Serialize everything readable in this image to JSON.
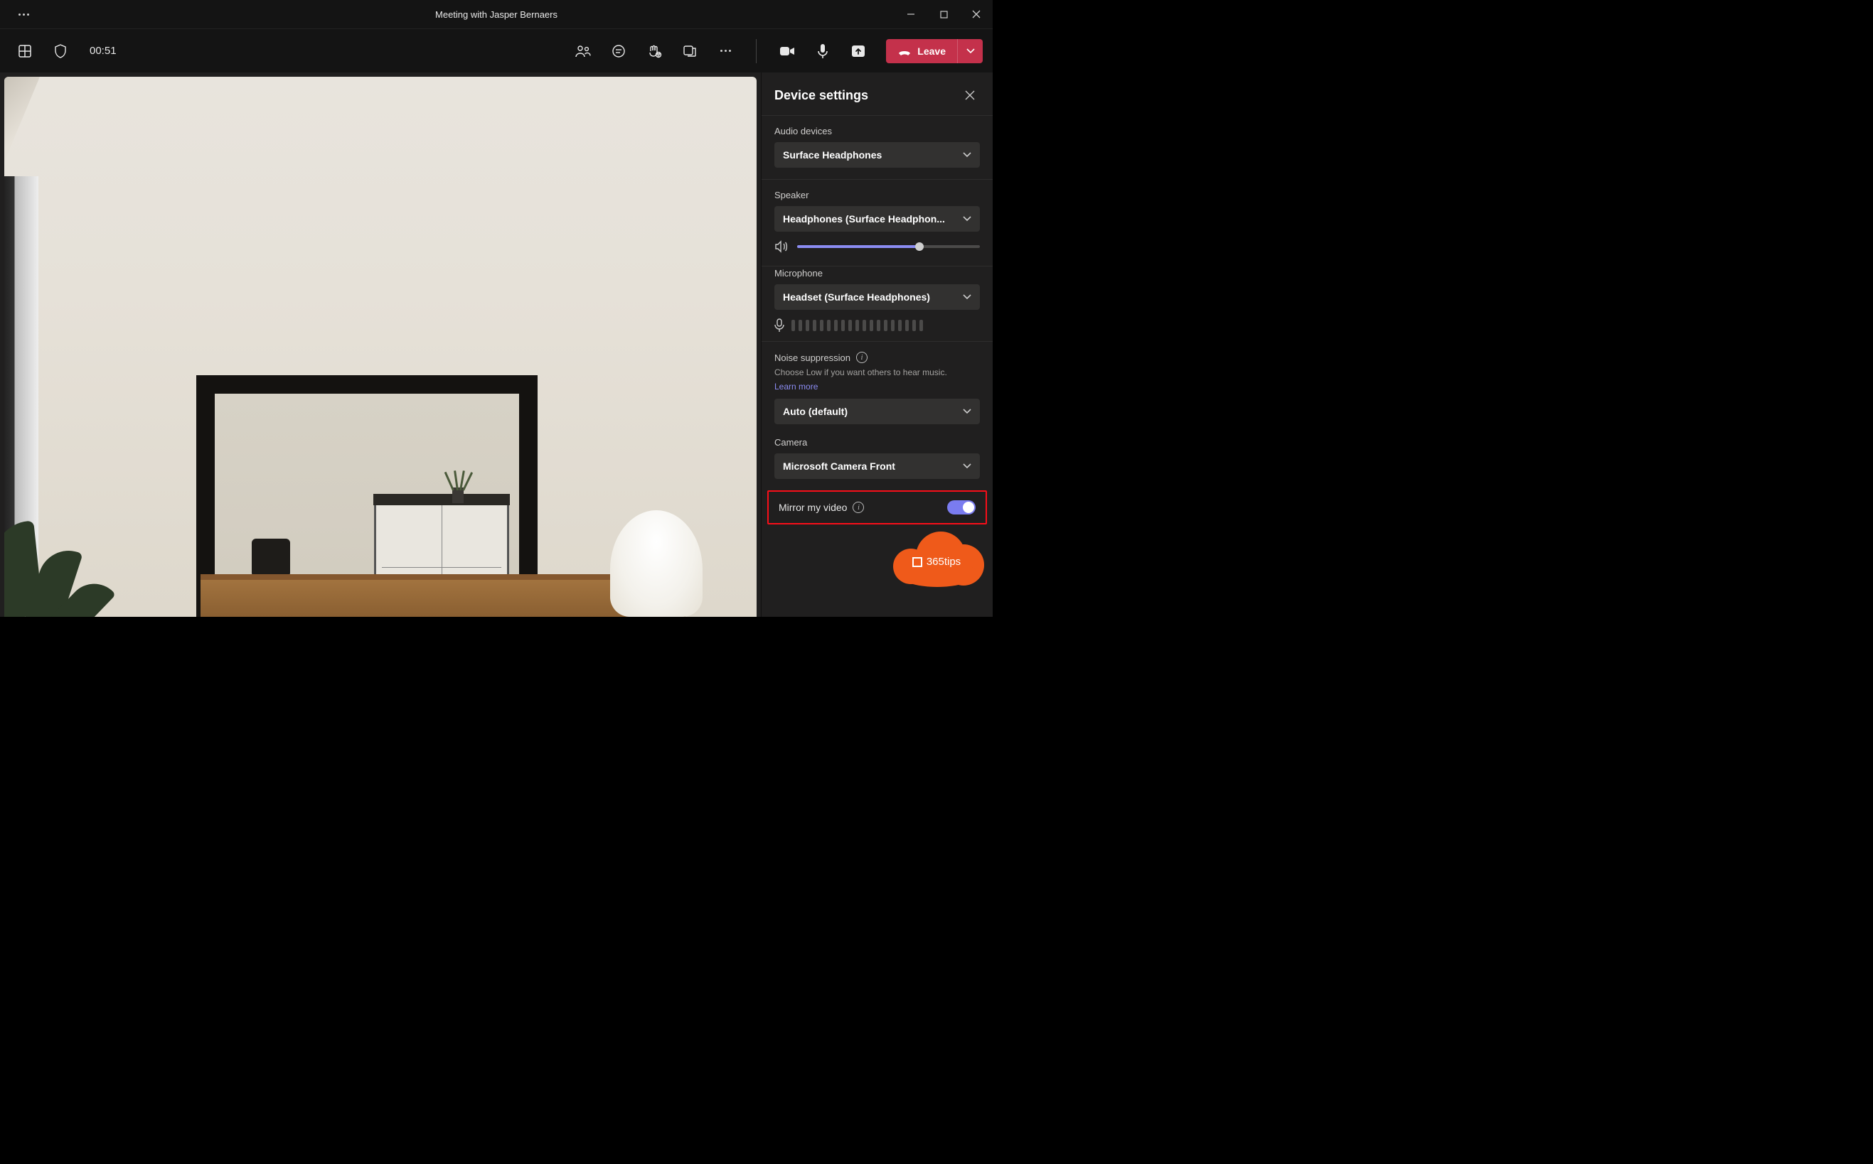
{
  "titlebar": {
    "title": "Meeting with Jasper Bernaers"
  },
  "toolbar": {
    "timer": "00:51",
    "leave_label": "Leave"
  },
  "panel": {
    "title": "Device settings",
    "audio_devices": {
      "label": "Audio devices",
      "value": "Surface Headphones"
    },
    "speaker": {
      "label": "Speaker",
      "value": "Headphones (Surface Headphon...",
      "volume_percent": 67
    },
    "microphone": {
      "label": "Microphone",
      "value": "Headset (Surface Headphones)"
    },
    "noise": {
      "label": "Noise suppression",
      "hint": "Choose Low if you want others to hear music.",
      "link": "Learn more",
      "value": "Auto (default)"
    },
    "camera": {
      "label": "Camera",
      "value": "Microsoft Camera Front"
    },
    "mirror": {
      "label": "Mirror my video",
      "on": true
    }
  },
  "badge": {
    "text": "365tips"
  }
}
